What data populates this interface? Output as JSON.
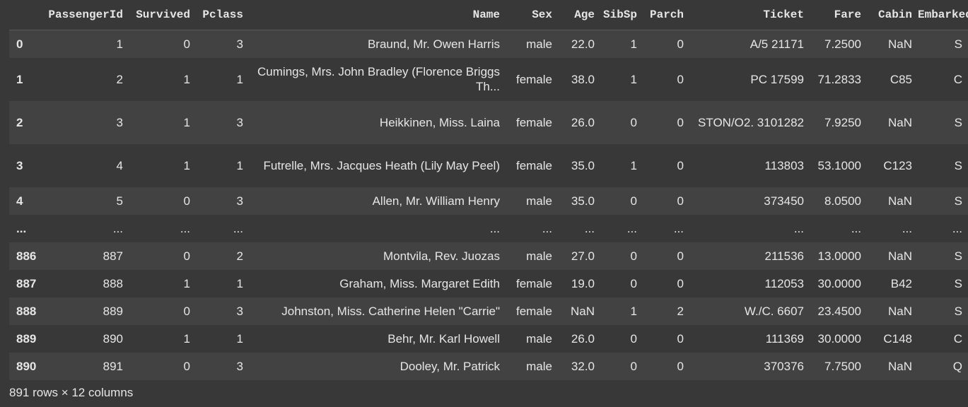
{
  "columns": [
    "",
    "PassengerId",
    "Survived",
    "Pclass",
    "Name",
    "Sex",
    "Age",
    "SibSp",
    "Parch",
    "Ticket",
    "Fare",
    "Cabin",
    "Embarked"
  ],
  "rows": [
    {
      "idx": "0",
      "tall": false,
      "cells": [
        "1",
        "0",
        "3",
        "Braund, Mr. Owen Harris",
        "male",
        "22.0",
        "1",
        "0",
        "A/5 21171",
        "7.2500",
        "NaN",
        "S"
      ]
    },
    {
      "idx": "1",
      "tall": true,
      "cells": [
        "2",
        "1",
        "1",
        "Cumings, Mrs. John Bradley (Florence Briggs Th...",
        "female",
        "38.0",
        "1",
        "0",
        "PC 17599",
        "71.2833",
        "C85",
        "C"
      ]
    },
    {
      "idx": "2",
      "tall": true,
      "cells": [
        "3",
        "1",
        "3",
        "Heikkinen, Miss. Laina",
        "female",
        "26.0",
        "0",
        "0",
        "STON/O2. 3101282",
        "7.9250",
        "NaN",
        "S"
      ]
    },
    {
      "idx": "3",
      "tall": true,
      "cells": [
        "4",
        "1",
        "1",
        "Futrelle, Mrs. Jacques Heath (Lily May Peel)",
        "female",
        "35.0",
        "1",
        "0",
        "113803",
        "53.1000",
        "C123",
        "S"
      ]
    },
    {
      "idx": "4",
      "tall": false,
      "cells": [
        "5",
        "0",
        "3",
        "Allen, Mr. William Henry",
        "male",
        "35.0",
        "0",
        "0",
        "373450",
        "8.0500",
        "NaN",
        "S"
      ]
    },
    {
      "idx": "...",
      "tall": false,
      "cells": [
        "...",
        "...",
        "...",
        "...",
        "...",
        "...",
        "...",
        "...",
        "...",
        "...",
        "...",
        "..."
      ]
    },
    {
      "idx": "886",
      "tall": false,
      "cells": [
        "887",
        "0",
        "2",
        "Montvila, Rev. Juozas",
        "male",
        "27.0",
        "0",
        "0",
        "211536",
        "13.0000",
        "NaN",
        "S"
      ]
    },
    {
      "idx": "887",
      "tall": false,
      "cells": [
        "888",
        "1",
        "1",
        "Graham, Miss. Margaret Edith",
        "female",
        "19.0",
        "0",
        "0",
        "112053",
        "30.0000",
        "B42",
        "S"
      ]
    },
    {
      "idx": "888",
      "tall": false,
      "cells": [
        "889",
        "0",
        "3",
        "Johnston, Miss. Catherine Helen \"Carrie\"",
        "female",
        "NaN",
        "1",
        "2",
        "W./C. 6607",
        "23.4500",
        "NaN",
        "S"
      ]
    },
    {
      "idx": "889",
      "tall": false,
      "cells": [
        "890",
        "1",
        "1",
        "Behr, Mr. Karl Howell",
        "male",
        "26.0",
        "0",
        "0",
        "111369",
        "30.0000",
        "C148",
        "C"
      ]
    },
    {
      "idx": "890",
      "tall": false,
      "cells": [
        "891",
        "0",
        "3",
        "Dooley, Mr. Patrick",
        "male",
        "32.0",
        "0",
        "0",
        "370376",
        "7.7500",
        "NaN",
        "Q"
      ]
    }
  ],
  "shape_text": "891 rows × 12 columns"
}
